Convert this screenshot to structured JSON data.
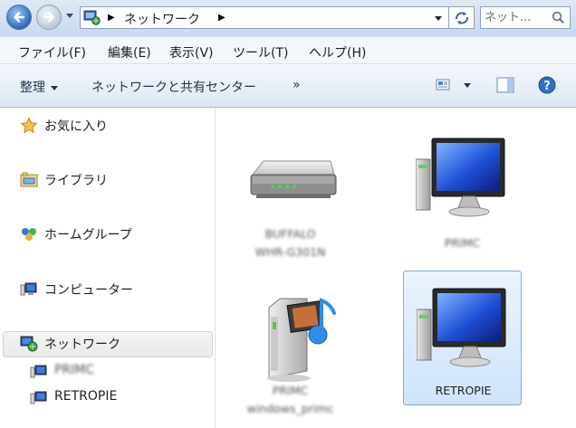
{
  "address": {
    "crumb": "ネットワーク"
  },
  "search": {
    "placeholder": "ネット..."
  },
  "menu": {
    "items": [
      "ファイル(F)",
      "編集(E)",
      "表示(V)",
      "ツール(T)",
      "ヘルプ(H)"
    ]
  },
  "toolbar": {
    "organize": "整理",
    "network_center": "ネットワークと共有センター",
    "more": "»"
  },
  "sidebar": {
    "items": [
      {
        "label": "お気に入り",
        "icon": "star-icon"
      },
      {
        "label": "ライブラリ",
        "icon": "library-icon"
      },
      {
        "label": "ホームグループ",
        "icon": "homegroup-icon"
      },
      {
        "label": "コンピューター",
        "icon": "computer-icon"
      },
      {
        "label": "ネットワーク",
        "icon": "network-icon",
        "selected": true
      }
    ],
    "network_children": [
      {
        "label": "PRIMC",
        "icon": "computer-icon",
        "blurred": true
      },
      {
        "label": "RETROPIE",
        "icon": "computer-icon"
      }
    ]
  },
  "content": {
    "tiles": [
      {
        "icon": "router-icon",
        "caption1": "BUFFALO",
        "caption2": "WHR-G301N",
        "blurred": true
      },
      {
        "icon": "computer-icon",
        "caption1": "PRIMC",
        "blurred": true
      },
      {
        "icon": "media-server-icon",
        "caption1": "PRIMC",
        "caption2": "windows_primc",
        "blurred": true
      },
      {
        "icon": "computer-icon",
        "caption1": "RETROPIE",
        "selected": true
      }
    ]
  },
  "colors": {
    "accent": "#2c6bc0",
    "selection": "#cfe4fb"
  }
}
